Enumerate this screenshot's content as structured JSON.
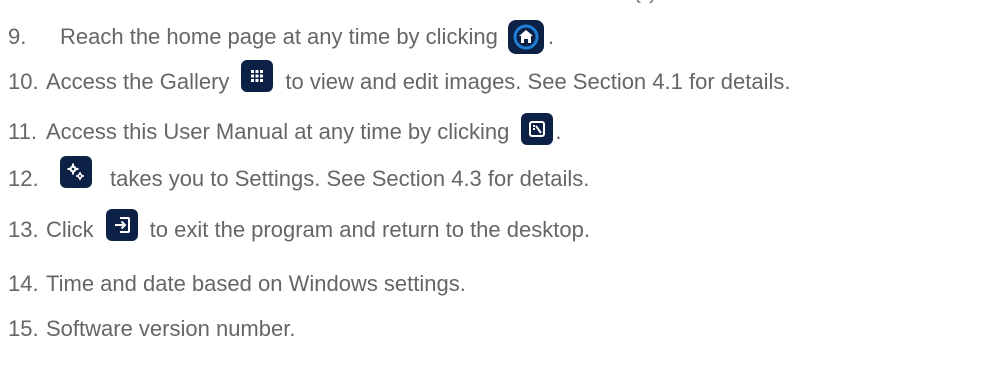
{
  "items": [
    {
      "num": "9.",
      "pre": "Reach the home page at any time by clicking",
      "icon": "home-icon",
      "post": "."
    },
    {
      "num": "10.",
      "pre": "Access the Gallery",
      "icon": "grid-icon",
      "post": "to view and edit images. See Section 4.1 for details."
    },
    {
      "num": "11.",
      "pre": "Access this User Manual at any time by clicking",
      "icon": "manual-icon",
      "post": "."
    },
    {
      "num": "12.",
      "pre": "",
      "icon": "settings-gears-icon",
      "post": "takes you to Settings. See Section 4.3 for details."
    },
    {
      "num": "13.",
      "pre": "Click",
      "icon": "exit-icon",
      "post": "to exit the program and return to the desktop."
    },
    {
      "num": "14.",
      "pre": "Time and date based on Windows settings.",
      "icon": "",
      "post": ""
    },
    {
      "num": "15.",
      "pre": "Software version number.",
      "icon": "",
      "post": ""
    }
  ],
  "colors": {
    "text": "#666666",
    "button": "#0c2145",
    "home_ring": "#1f7fd6"
  }
}
